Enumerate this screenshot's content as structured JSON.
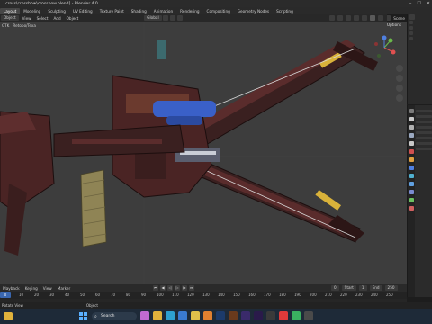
{
  "titlebar": {
    "title": "...cross\\crossbow\\crossbow.blend] - Blender 4.0",
    "icons": [
      "minimize-icon",
      "maximize-icon",
      "close-icon"
    ]
  },
  "menubar": {
    "tabs": [
      "Layout",
      "Modeling",
      "Sculpting",
      "UV Editing",
      "Texture Paint",
      "Shading",
      "Animation",
      "Rendering",
      "Compositing",
      "Geometry Nodes",
      "Scripting"
    ],
    "active_tab": "Layout",
    "scene_label": "Scene"
  },
  "toolbar": {
    "mode": "Object",
    "items": [
      "View",
      "Select",
      "Add",
      "Object"
    ],
    "orientation": "Global",
    "extra": "dot Bus"
  },
  "viewport": {
    "view_label": "GTK",
    "object": "Retopo/Texa",
    "options_label": "Options"
  },
  "timeline": {
    "playback_label": "Playback",
    "keying_label": "Keying",
    "view_label": "View",
    "marker_label": "Marker",
    "current_frame": "0",
    "start_label": "Start",
    "start_value": "1",
    "end_label": "End",
    "end_value": "250",
    "ruler_ticks": [
      "0",
      "10",
      "20",
      "30",
      "40",
      "50",
      "60",
      "70",
      "80",
      "90",
      "100",
      "110",
      "120",
      "130",
      "140",
      "150",
      "160",
      "170",
      "180",
      "190",
      "200",
      "210",
      "220",
      "230",
      "240",
      "250"
    ]
  },
  "statusbar": {
    "left": "Rotate View",
    "middle": "Object"
  },
  "taskbar": {
    "search_placeholder": "Search"
  },
  "colors": {
    "accent": "#3a67b0",
    "viewport_bg": "#3d3d3d",
    "panel_bg": "#2a2a2a",
    "weapon_body": "#4a2424",
    "weapon_blue": "#3a60c8",
    "weapon_yellow": "#d9b23a"
  }
}
